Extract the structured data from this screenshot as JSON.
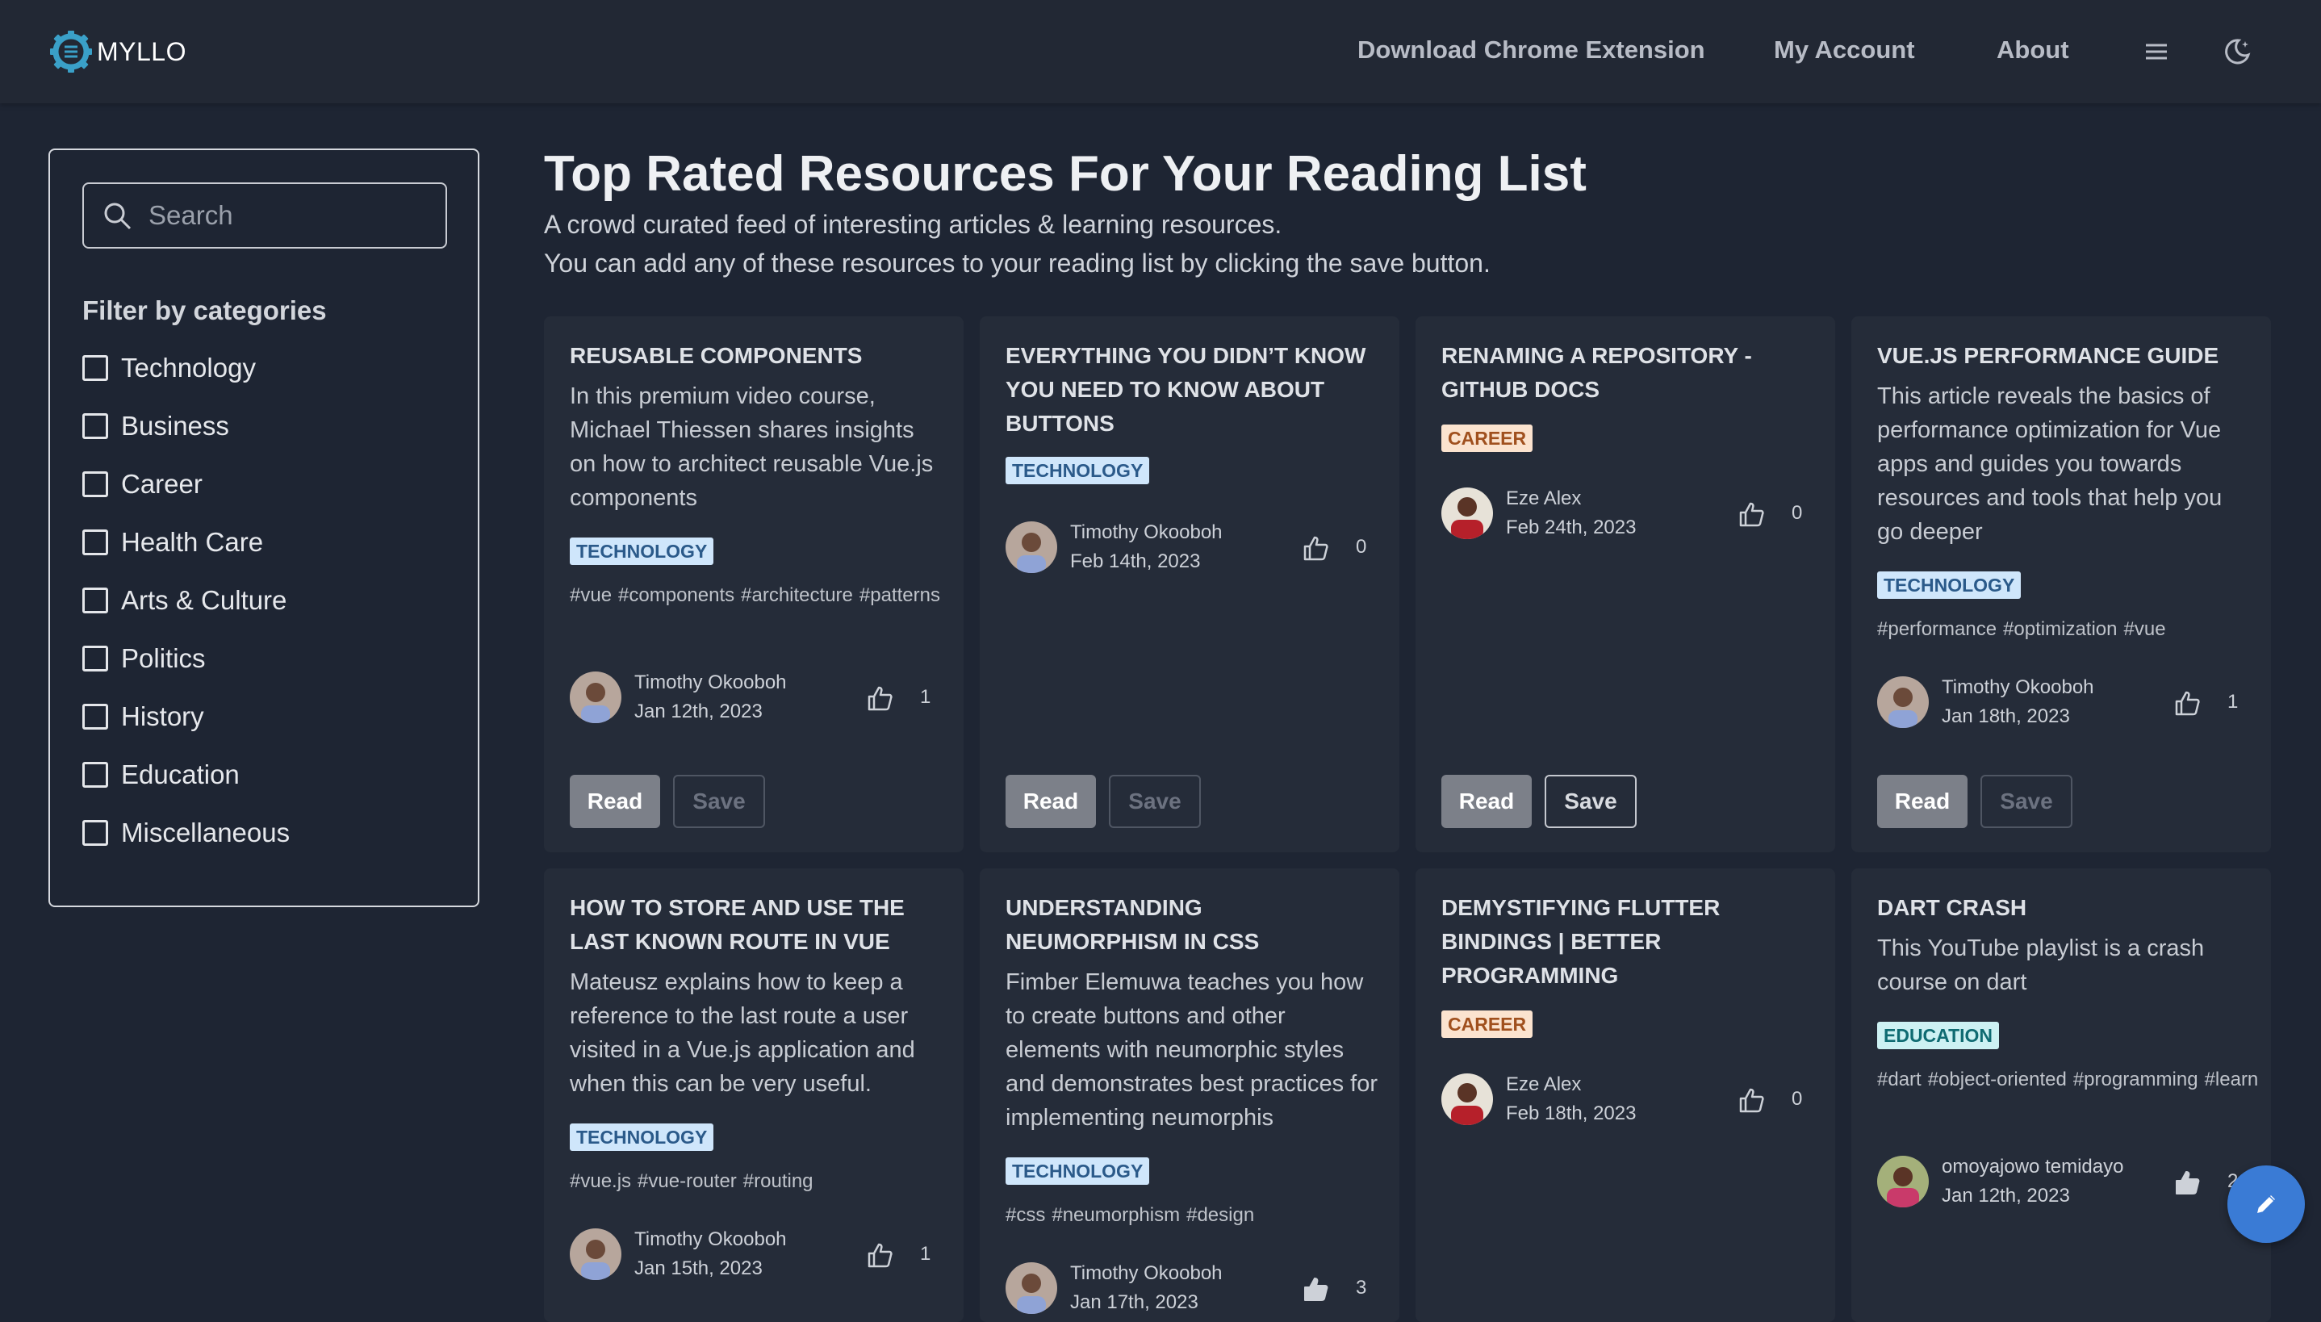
{
  "header": {
    "brand": "MYLLO",
    "nav": {
      "extension": "Download Chrome Extension",
      "account": "My Account",
      "about": "About"
    },
    "icons": [
      "cog-logo-icon",
      "hamburger-menu-icon",
      "moon-theme-icon"
    ]
  },
  "sidebar": {
    "search_placeholder": "Search",
    "filter_title": "Filter by categories",
    "categories": [
      "Technology",
      "Business",
      "Career",
      "Health Care",
      "Arts & Culture",
      "Politics",
      "History",
      "Education",
      "Miscellaneous"
    ]
  },
  "main": {
    "title": "Top Rated Resources For Your Reading List",
    "subtitle_1": "A crowd curated feed of interesting articles & learning resources.",
    "subtitle_2": "You can add any of these resources to your reading list by clicking the save button."
  },
  "labels": {
    "read": "Read",
    "save": "Save"
  },
  "colors": {
    "tech_badge": "#cfe6fb",
    "career_badge": "#fbe3cf",
    "education_badge": "#cdf1f3",
    "fab": "#3a7bd5"
  },
  "cards": [
    {
      "title": "Reusable Components",
      "description": "In this premium video course, Michael Thiessen shares insights on how to architect reusable Vue.js components",
      "tag": "TECHNOLOGY",
      "hashtags": [
        "#vue",
        "#components",
        "#architecture",
        "#patterns"
      ],
      "author": "Timothy Okooboh",
      "date": "Jan 12th, 2023",
      "likes": "1",
      "save_enabled": false
    },
    {
      "title": "Everything You Didn’t Know You Need to Know About Buttons",
      "description": "",
      "tag": "TECHNOLOGY",
      "hashtags": [],
      "author": "Timothy Okooboh",
      "date": "Feb 14th, 2023",
      "likes": "0",
      "save_enabled": false
    },
    {
      "title": "Renaming a repository - GitHub Docs",
      "description": "",
      "tag": "CAREER",
      "hashtags": [],
      "author": "Eze Alex",
      "date": "Feb 24th, 2023",
      "likes": "0",
      "save_enabled": true
    },
    {
      "title": "Vue.js Performance Guide",
      "description": "This article reveals the basics of performance optimization for Vue apps and guides you towards resources and tools that help you go deeper",
      "tag": "TECHNOLOGY",
      "hashtags": [
        "#performance",
        "#optimization",
        "#vue"
      ],
      "author": "Timothy Okooboh",
      "date": "Jan 18th, 2023",
      "likes": "1",
      "save_enabled": false
    },
    {
      "title": "How to Store and Use the Last Known Route in Vue",
      "description": "Mateusz explains how to keep a reference to the last route a user visited in a Vue.js application and when this can be very useful.",
      "tag": "TECHNOLOGY",
      "hashtags": [
        "#vue.js",
        "#vue-router",
        "#routing"
      ],
      "author": "Timothy Okooboh",
      "date": "Jan 15th, 2023",
      "likes": "1"
    },
    {
      "title": "Understanding Neumorphism in CSS",
      "description": "Fimber Elemuwa teaches you how to create buttons and other elements with neumorphic styles and demonstrates best practices for implementing neumorphis",
      "tag": "TECHNOLOGY",
      "hashtags": [
        "#css",
        "#neumorphism",
        "#design"
      ],
      "author": "Timothy Okooboh",
      "date": "Jan 17th, 2023",
      "likes": "3"
    },
    {
      "title": "Demystifying Flutter Bindings | Better Programming",
      "description": "",
      "tag": "CAREER",
      "hashtags": [],
      "author": "Eze Alex",
      "date": "Feb 18th, 2023",
      "likes": "0"
    },
    {
      "title": "Dart Crash",
      "description": "This YouTube playlist is a crash course on dart",
      "tag": "EDUCATION",
      "hashtags": [
        "#dart",
        "#object-oriented",
        "#programming",
        "#learn"
      ],
      "author": "omoyajowo temidayo",
      "date": "Jan 12th, 2023",
      "likes": "2"
    }
  ]
}
